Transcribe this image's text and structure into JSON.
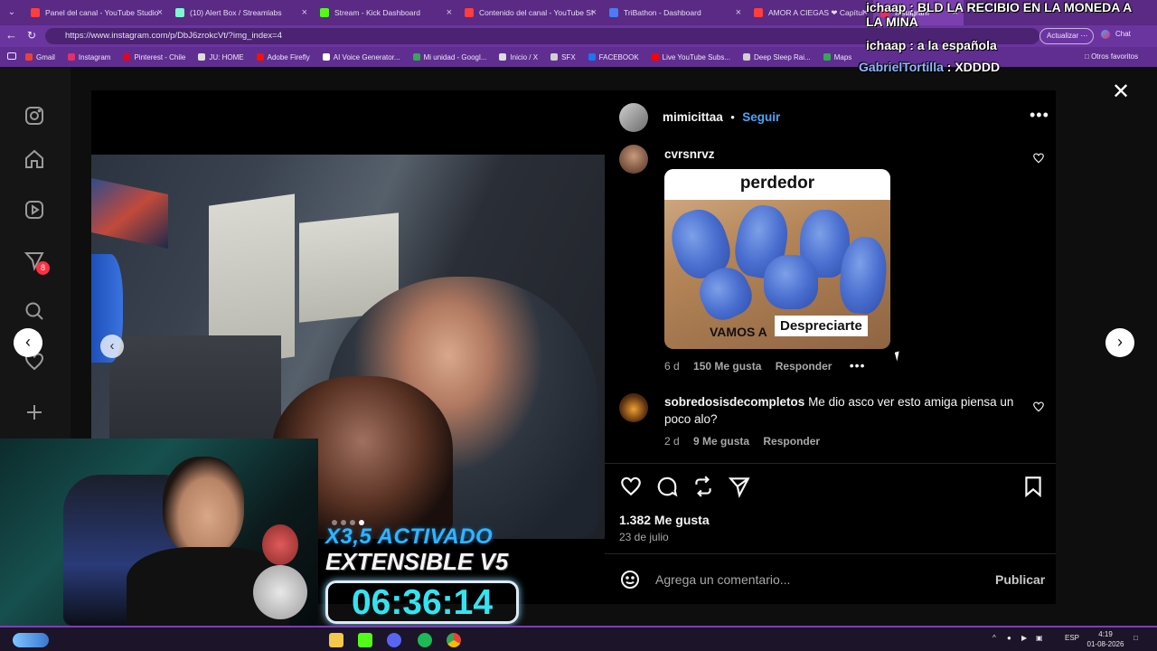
{
  "browser": {
    "tabs": [
      {
        "label": "Panel del canal - YouTube Studio",
        "color": "#ff3d3d",
        "active": false
      },
      {
        "label": "(10) Alert Box / Streamlabs",
        "color": "#80f5d2",
        "active": false
      },
      {
        "label": "Stream - Kick Dashboard",
        "color": "#53fc18",
        "active": false
      },
      {
        "label": "Contenido del canal - YouTube St...",
        "color": "#ff3d3d",
        "active": false
      },
      {
        "label": "TriBathon - Dashboard",
        "color": "#4a7df5",
        "active": false
      },
      {
        "label": "AMOR A CIEGAS ❤ Capítulo 8",
        "color": "#ff3d3d",
        "active": false
      },
      {
        "label": "Instagram",
        "color": "#e1306c",
        "active": true
      }
    ],
    "url": "https://www.instagram.com/p/DbJ6zrokcVt/?img_index=4",
    "update_label": "Actualizar",
    "chat_label": "Chat",
    "bookmarks": [
      {
        "label": "Gmail",
        "color": "#ea4335"
      },
      {
        "label": "Instagram",
        "color": "#e1306c"
      },
      {
        "label": "Pinterest - Chile",
        "color": "#e60023"
      },
      {
        "label": "JU: HOME",
        "color": "#dddddd"
      },
      {
        "label": "Adobe Firefly",
        "color": "#fa0f00"
      },
      {
        "label": "AI Voice Generator...",
        "color": "#ffffff"
      },
      {
        "label": "Mi unidad - Googl...",
        "color": "#34a853"
      },
      {
        "label": "Inicio / X",
        "color": "#dddddd"
      },
      {
        "label": "SFX",
        "color": "#cfcfcf"
      },
      {
        "label": "FACEBOOK",
        "color": "#1877f2"
      },
      {
        "label": "Live YouTube Subs...",
        "color": "#ff0000"
      },
      {
        "label": "Deep Sleep Rai...",
        "color": "#cfcfcf"
      },
      {
        "label": "Maps",
        "color": "#34a853"
      }
    ],
    "other_favorites": "Otros favoritos"
  },
  "chat_overlay": [
    {
      "user": "ichaap",
      "message": "BLD LA RECIBIO EN LA MONEDA A LA MINA",
      "color": "white"
    },
    {
      "user": "ichaap",
      "message": "a la española",
      "color": "white"
    },
    {
      "user": "GabrielTortilla",
      "message": "XDDDD",
      "color": "blue"
    }
  ],
  "post": {
    "author": "mimicittaa",
    "follow_label": "Seguir",
    "likes": "1.382 Me gusta",
    "date": "23 de julio",
    "comment_placeholder": "Agrega un comentario...",
    "publish_label": "Publicar",
    "carousel_dots": 4,
    "carousel_active": 4
  },
  "comments": [
    {
      "user": "cvrsnrvz",
      "text": "",
      "age": "6 d",
      "likes": "150 Me gusta",
      "reply": "Responder",
      "gif": {
        "top_text": "perdedor",
        "bottom_small": "VAMOS A",
        "bottom_big": "Despreciarte"
      }
    },
    {
      "user": "sobredosisdecompletos",
      "text": "Me dio asco ver esto amiga piensa un poco alo?",
      "age": "2 d",
      "likes": "9 Me gusta",
      "reply": "Responder"
    }
  ],
  "sidebar": {
    "notification_count": "8"
  },
  "stream_overlay": {
    "multiplier": "X3,5 ACTIVADO",
    "subtitle": "EXTENSIBLE V5",
    "timer": "06:36:14"
  },
  "taskbar": {
    "language": "ESP",
    "time": "4:19",
    "date": "01-08-2026"
  }
}
